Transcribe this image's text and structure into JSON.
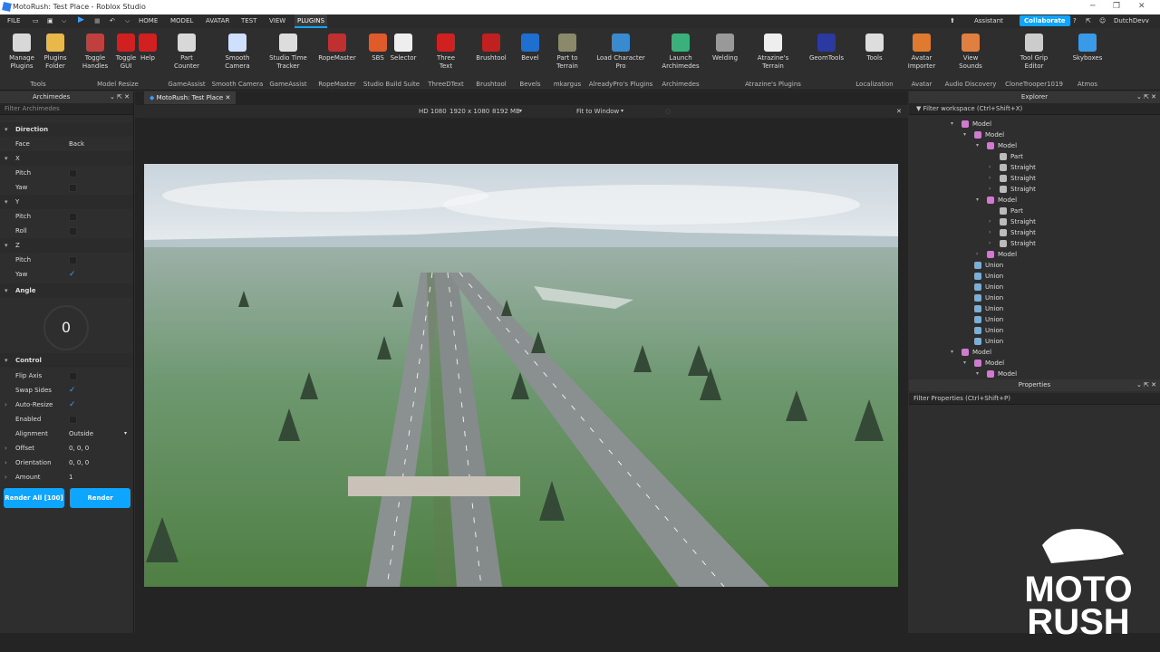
{
  "window": {
    "title": "MotoRush: Test Place - Roblox Studio"
  },
  "menu": {
    "items": [
      "FILE",
      "HOME",
      "MODEL",
      "AVATAR",
      "TEST",
      "VIEW",
      "PLUGINS"
    ],
    "active": "PLUGINS",
    "assistant": "Assistant",
    "collaborate": "Collaborate",
    "user": "DutchDevv"
  },
  "ribbon": {
    "buttons": [
      {
        "label": "Manage\nPlugins",
        "icon": "wrench-icon",
        "color": "#d8d8d8"
      },
      {
        "label": "Plugins\nFolder",
        "icon": "folder-icon",
        "color": "#e8b84a"
      },
      {
        "label": "Toggle\nHandles",
        "icon": "toggle-handles-icon",
        "color": "#c04040"
      },
      {
        "label": "Toggle\nGUI",
        "icon": "toggle-gui-icon",
        "color": "#d02020"
      },
      {
        "label": "Help",
        "icon": "help-icon",
        "color": "#d02020"
      },
      {
        "label": "Part\nCounter",
        "icon": "part-counter-icon",
        "color": "#d8d8d8"
      },
      {
        "label": "Smooth\nCamera",
        "icon": "camera-icon",
        "color": "#cfe0ff"
      },
      {
        "label": "Studio Time\nTracker",
        "icon": "clock-icon",
        "color": "#dddddd"
      },
      {
        "label": "RopeMaster",
        "icon": "rope-icon",
        "color": "#c03030"
      },
      {
        "label": "SBS",
        "icon": "sbs-icon",
        "color": "#e05a2a"
      },
      {
        "label": "Selector",
        "icon": "cursor-icon",
        "color": "#eeeeee"
      },
      {
        "label": "Three\nText",
        "icon": "text-3d-icon",
        "color": "#d02020"
      },
      {
        "label": "Brushtool",
        "icon": "brush-icon",
        "color": "#c02020"
      },
      {
        "label": "Bevel",
        "icon": "bevel-icon",
        "color": "#1f6fd1"
      },
      {
        "label": "Part to\nTerrain",
        "icon": "terrain-sphere-icon",
        "color": "#8a8a6a"
      },
      {
        "label": "Load Character\nPro",
        "icon": "character-icon",
        "color": "#3a8ad0"
      },
      {
        "label": "Launch\nArchimedes",
        "icon": "archimedes-icon",
        "color": "#3ab07a"
      },
      {
        "label": "Welding",
        "icon": "weld-icon",
        "color": "#999999"
      },
      {
        "label": "Atrazine's\nTerrain",
        "icon": "att-icon",
        "color": "#eeeeee"
      },
      {
        "label": "GeomTools",
        "icon": "geom-icon",
        "color": "#2a3aa0"
      },
      {
        "label": "Tools",
        "icon": "globe-icon",
        "color": "#dddddd"
      },
      {
        "label": "Avatar\nImporter",
        "icon": "avatar-icon",
        "color": "#e07a30"
      },
      {
        "label": "View\nSounds",
        "icon": "sound-icon",
        "color": "#e08040"
      },
      {
        "label": "Tool Grip\nEditor",
        "icon": "grip-icon",
        "color": "#cccccc"
      },
      {
        "label": "Skyboxes",
        "icon": "cloud-icon",
        "color": "#3a9ae8"
      }
    ],
    "groups": [
      "Tools",
      "Model Resize",
      "GameAssist",
      "Smooth Camera",
      "GameAssist",
      "RopeMaster",
      "Studio Build Suite",
      "ThreeDText",
      "Brushtool",
      "Bevels",
      "mkargus",
      "AlreadyPro's Plugins",
      "Archimedes",
      "Atrazine's Plugins",
      "Localization",
      "Avatar",
      "Audio Discovery",
      "CloneTrooper1019",
      "Atmos"
    ]
  },
  "archimedes": {
    "title": "Archimedes",
    "filter": "Filter Archimedes",
    "direction": {
      "label": "Direction",
      "face_label": "Face",
      "face_value": "Back"
    },
    "x": {
      "label": "X",
      "pitch": "Pitch",
      "yaw": "Yaw"
    },
    "y": {
      "label": "Y",
      "pitch": "Pitch",
      "roll": "Roll"
    },
    "z": {
      "label": "Z",
      "pitch": "Pitch",
      "yaw": "Yaw"
    },
    "angle": {
      "label": "Angle",
      "value": "0"
    },
    "control": {
      "label": "Control",
      "flip": "Flip Axis",
      "swap": "Swap Sides",
      "autoresize": "Auto-Resize",
      "enabled": "Enabled",
      "alignment": "Alignment",
      "alignment_value": "Outside",
      "offset": "Offset",
      "offset_value": "0, 0, 0",
      "orientation": "Orientation",
      "orientation_value": "0, 0, 0",
      "amount": "Amount",
      "amount_value": "1"
    },
    "render_all": "Render All [100]",
    "render": "Render"
  },
  "viewport": {
    "tab": "MotoRush: Test Place",
    "device": "HD 1080",
    "resolution": "1920 x 1080",
    "memory": "8192 MB",
    "fit": "Fit to Window"
  },
  "explorer": {
    "title": "Explorer",
    "filter": "Filter workspace (Ctrl+Shift+X)",
    "items": [
      {
        "label": "Model",
        "type": "model"
      },
      {
        "label": "Model",
        "type": "model"
      },
      {
        "label": "Model",
        "type": "model"
      },
      {
        "label": "Part",
        "type": "part"
      },
      {
        "label": "Straight",
        "type": "part"
      },
      {
        "label": "Straight",
        "type": "part"
      },
      {
        "label": "Straight",
        "type": "part"
      },
      {
        "label": "Model",
        "type": "model"
      },
      {
        "label": "Part",
        "type": "part"
      },
      {
        "label": "Straight",
        "type": "part"
      },
      {
        "label": "Straight",
        "type": "part"
      },
      {
        "label": "Straight",
        "type": "part"
      },
      {
        "label": "Model",
        "type": "model"
      },
      {
        "label": "Union",
        "type": "union"
      },
      {
        "label": "Union",
        "type": "union"
      },
      {
        "label": "Union",
        "type": "union"
      },
      {
        "label": "Union",
        "type": "union"
      },
      {
        "label": "Union",
        "type": "union"
      },
      {
        "label": "Union",
        "type": "union"
      },
      {
        "label": "Union",
        "type": "union"
      },
      {
        "label": "Union",
        "type": "union"
      },
      {
        "label": "Model",
        "type": "model"
      },
      {
        "label": "Model",
        "type": "model"
      },
      {
        "label": "Model",
        "type": "model"
      }
    ]
  },
  "properties": {
    "title": "Properties",
    "filter": "Filter Properties (Ctrl+Shift+P)"
  },
  "watermark": {
    "line1": "MOTO",
    "line2": "RUSH"
  }
}
